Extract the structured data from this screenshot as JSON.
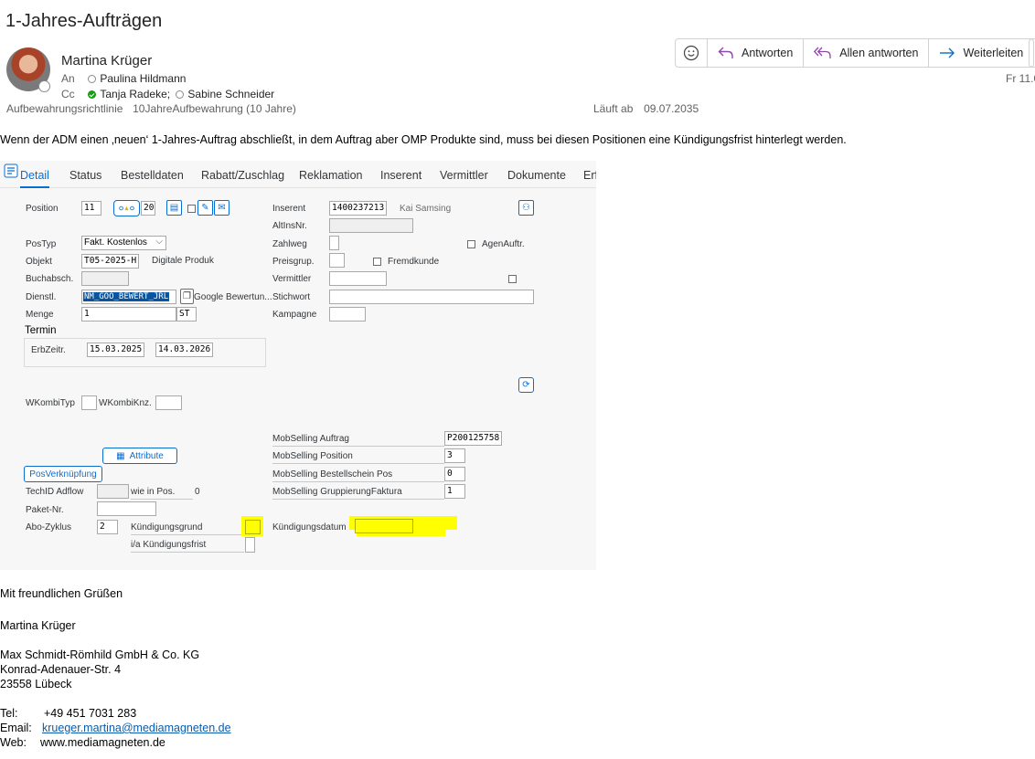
{
  "email": {
    "subject": "1-Jahres-Aufträgen",
    "sender": "Martina Krüger",
    "to_label": "An",
    "to": "Paulina Hildmann",
    "cc_label": "Cc",
    "cc_1": "Tanja Radeke;",
    "cc_2": "Sabine Schneider",
    "retention_label": "Aufbewahrungsrichtlinie",
    "retention_value": "10JahreAufbewahrung (10 Jahre)",
    "expires_label": "Läuft ab",
    "expires_value": "09.07.2035",
    "date": "Fr 11.0",
    "actions": {
      "reply": "Antworten",
      "reply_all": "Allen antworten",
      "forward": "Weiterleiten"
    },
    "body_text": "Wenn der ADM einen ‚neuen‘ 1-Jahres-Auftrag abschließt, in dem Auftrag aber OMP Produkte sind, muss bei diesen Positionen eine Kündigungsfrist hinterlegt werden."
  },
  "sap": {
    "tabs": [
      "Detail",
      "Status",
      "Bestelldaten",
      "Rabatt/Zuschlag",
      "Reklamation",
      "Inserent",
      "Vermittler",
      "Dokumente",
      "Erf"
    ],
    "left": {
      "position_label": "Position",
      "position_value": "11",
      "position_count": "20",
      "postyp_label": "PosTyp",
      "postyp_value": "Fakt. Kostenlos",
      "objekt_label": "Objekt",
      "objekt_value": "T05-2025-H",
      "objekt_desc": "Digitale Produk",
      "buchabsch_label": "Buchabsch.",
      "dienstl_label": "Dienstl.",
      "dienstl_value": "NM_GOO_BEWERT_JRL",
      "dienstl_desc": "Google Bewertun...",
      "menge_label": "Menge",
      "menge_value": "1",
      "menge_unit": "ST",
      "termin_label": "Termin",
      "erbzeitr_label": "ErbZeitr.",
      "erbzeitr_from": "15.03.2025",
      "erbzeitr_to": "14.03.2026",
      "wkombityp_label": "WKombiTyp",
      "wkombiknz_label": "WKombiKnz.",
      "attribute_button": "Attribute",
      "posverkn_button": "PosVerknüpfung",
      "techid_label": "TechID Adflow",
      "wie_in_pos_label": "wie in Pos.",
      "wie_in_pos_value": "0",
      "paket_label": "Paket-Nr.",
      "abo_label": "Abo-Zyklus",
      "abo_value": "2",
      "kuendigungsgrund_label": "Kündigungsgrund",
      "ia_kuendigungsfrist_label": "i/a Kündigungsfrist"
    },
    "right": {
      "inserent_label": "Inserent",
      "inserent_value": "1400237213",
      "inserent_name": "Kai Samsing",
      "altinsnr_label": "AltInsNr.",
      "zahlweg_label": "Zahlweg",
      "agenauftr_label": "AgenAuftr.",
      "preisgrup_label": "Preisgrup.",
      "fremdkunde_label": "Fremdkunde",
      "vermittler_label": "Vermittler",
      "stichwort_label": "Stichwort",
      "kampagne_label": "Kampagne",
      "mob_auftrag_label": "MobSelling Auftrag",
      "mob_auftrag_value": "P200125758",
      "mob_position_label": "MobSelling Position",
      "mob_position_value": "3",
      "mob_bestell_label": "MobSelling Bestellschein Pos",
      "mob_bestell_value": "0",
      "mob_grupp_label": "MobSelling GruppierungFaktura",
      "mob_grupp_value": "1",
      "kuendigungsdatum_label": "Kündigungsdatum"
    },
    "highlight_color": "#ffff00"
  },
  "signature": {
    "greeting": "Mit freundlichen Grüßen",
    "name": "Martina Krüger",
    "company": "Max Schmidt-Römhild GmbH & Co. KG",
    "street": "Konrad-Adenauer-Str. 4",
    "city": "23558 Lübeck",
    "tel_label": "Tel:",
    "tel": "+49 451 7031 283",
    "email_label": "Email:",
    "email": "krueger.martina@mediamagneten.de",
    "web_label": "Web:",
    "web": "www.mediamagneten.de"
  }
}
